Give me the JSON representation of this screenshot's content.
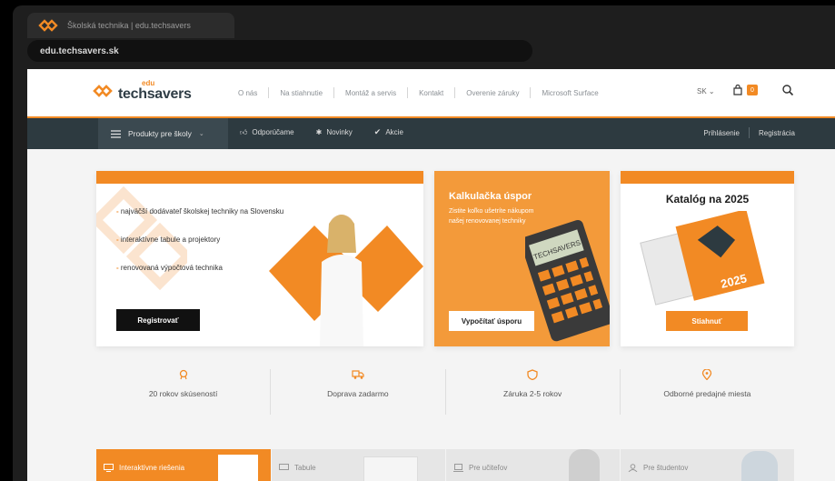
{
  "browser": {
    "tab_title": "Školská technika | edu.techsavers",
    "url": "edu.techsavers.sk"
  },
  "header": {
    "logo_edu": "edu",
    "logo_main": "techsavers",
    "nav": [
      "O nás",
      "Na stiahnutie",
      "Montáž a servis",
      "Kontakt",
      "Overenie záruky",
      "Microsoft Surface"
    ],
    "lang": "SK ⌄",
    "cart_count": "0"
  },
  "mainnav": {
    "products": "Produkty pre školy",
    "links": [
      "Odporúčame",
      "Novinky",
      "Akcie"
    ],
    "login": "Prihlásenie",
    "register": "Registrácia"
  },
  "promo": {
    "bullets": [
      "najväčší dodávateľ školskej techniky na Slovensku",
      "interaktívne tabule a projektory",
      "renovovaná výpočtová technika"
    ],
    "cta": "Registrovať"
  },
  "calc": {
    "title": "Kalkulačka úspor",
    "text": "Zistite koľko ušetríte nákupom našej renovovanej techniky",
    "display": "TECHSAVERS",
    "cta": "Vypočítať úsporu"
  },
  "catalog": {
    "title": "Katalóg na 2025",
    "year": "2025",
    "cta": "Stiahnuť"
  },
  "features": [
    {
      "icon": "medal-icon",
      "label": "20 rokov skúseností"
    },
    {
      "icon": "truck-icon",
      "label": "Doprava zadarmo"
    },
    {
      "icon": "shield-icon",
      "label": "Záruka 2-5 rokov"
    },
    {
      "icon": "location-pin-icon",
      "label": "Odborné predajné miesta"
    }
  ],
  "tiles": [
    {
      "label": "Interaktívne riešenia",
      "active": true
    },
    {
      "label": "Tabule",
      "active": false
    },
    {
      "label": "Pre učiteľov",
      "active": false
    },
    {
      "label": "Pre študentov",
      "active": false
    }
  ],
  "colors": {
    "accent": "#f28a24",
    "nav_dark": "#2d3a40"
  }
}
